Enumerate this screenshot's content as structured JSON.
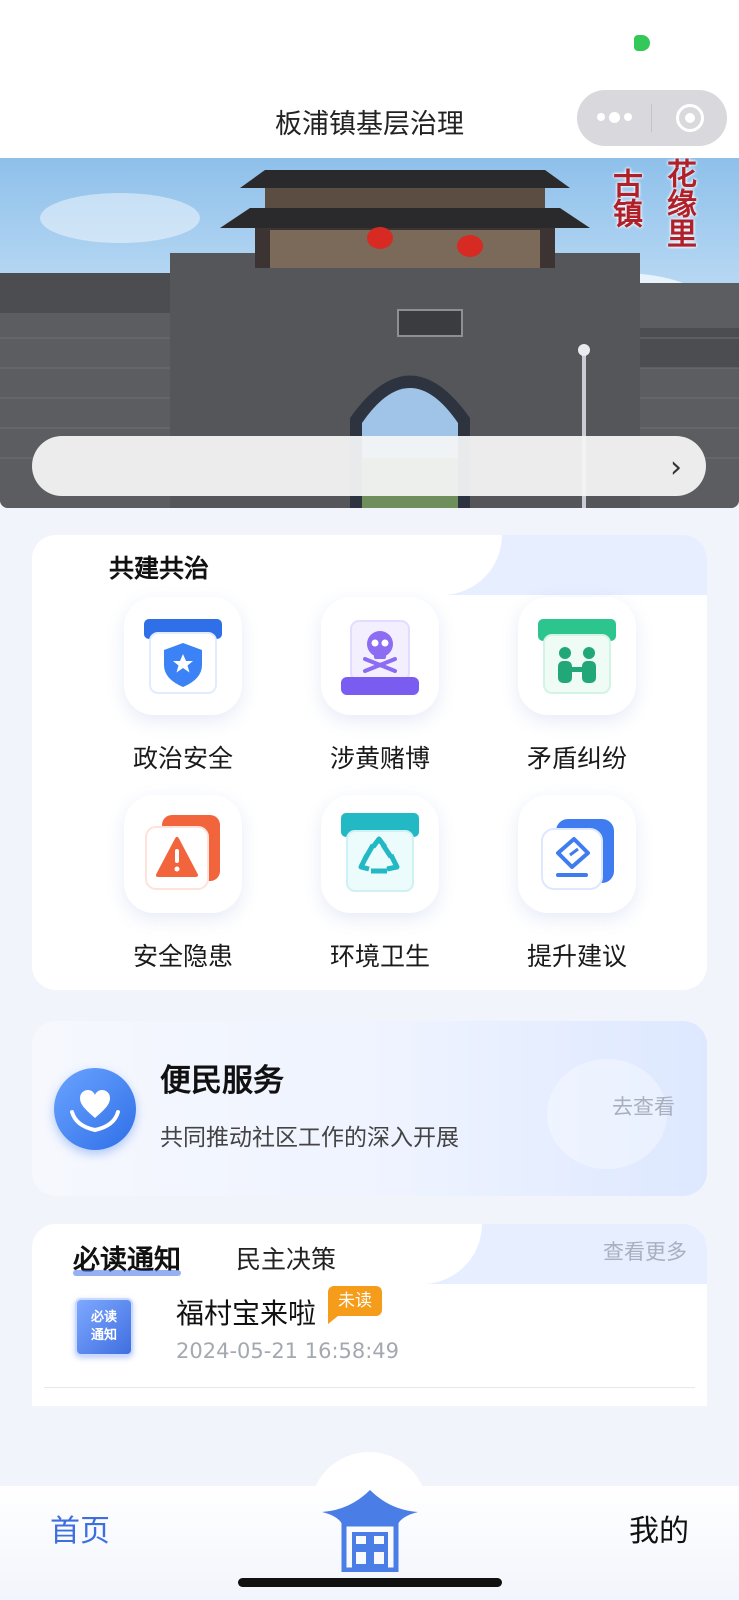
{
  "nav": {
    "title": "板浦镇基层治理"
  },
  "banner": {
    "calligraphy_col1": "古镇",
    "calligraphy_col2": "花缘里",
    "notice_text": ""
  },
  "governance": {
    "title": "共建共治",
    "items": [
      {
        "label": "政治安全",
        "icon": "shield-star-icon",
        "color": "#2f6fe8"
      },
      {
        "label": "涉黄赌博",
        "icon": "skull-icon",
        "color": "#7b5cf0"
      },
      {
        "label": "矛盾纠纷",
        "icon": "people-conflict-icon",
        "color": "#2cc58e"
      },
      {
        "label": "安全隐患",
        "icon": "warning-icon",
        "color": "#f2643c"
      },
      {
        "label": "环境卫生",
        "icon": "recycle-icon",
        "color": "#22b8c4"
      },
      {
        "label": "提升建议",
        "icon": "suggestion-edit-icon",
        "color": "#3f7cf0"
      }
    ]
  },
  "service": {
    "title": "便民服务",
    "subtitle": "共同推动社区工作的深入开展",
    "link": "去查看"
  },
  "notices": {
    "tabs": [
      "必读通知",
      "民主决策"
    ],
    "more": "查看更多",
    "thumb_line1": "必读",
    "thumb_line2": "通知",
    "items": [
      {
        "title": "福村宝来啦",
        "badge": "未读",
        "time": "2024-05-21 16:58:49"
      }
    ]
  },
  "tabbar": {
    "home": "首页",
    "mine": "我的"
  }
}
